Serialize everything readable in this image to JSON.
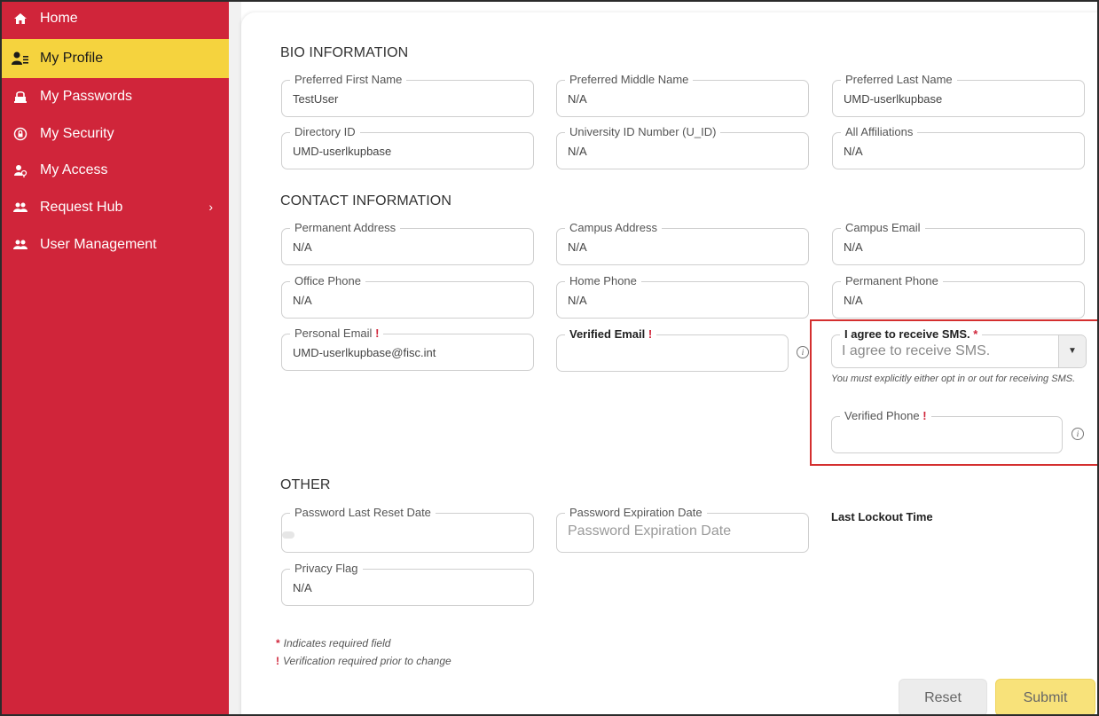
{
  "sidebar": {
    "items": [
      {
        "label": "Home",
        "icon": "home-icon"
      },
      {
        "label": "My Profile",
        "icon": "profile-icon"
      },
      {
        "label": "My Passwords",
        "icon": "password-icon"
      },
      {
        "label": "My Security",
        "icon": "security-icon"
      },
      {
        "label": "My Access",
        "icon": "access-icon"
      },
      {
        "label": "Request Hub",
        "icon": "users-icon"
      },
      {
        "label": "User Management",
        "icon": "users-icon"
      }
    ],
    "active_index": 1,
    "colors": {
      "background": "#d0253a",
      "active": "#f5d33e"
    }
  },
  "sections": {
    "bio": "BIO INFORMATION",
    "contact": "CONTACT INFORMATION",
    "other": "OTHER"
  },
  "bio": {
    "first_name": {
      "label": "Preferred First Name",
      "value": "TestUser"
    },
    "middle_name": {
      "label": "Preferred Middle Name",
      "value": "N/A"
    },
    "last_name": {
      "label": "Preferred Last Name",
      "value": "UMD-userlkupbase"
    },
    "directory_id": {
      "label": "Directory ID",
      "value": "UMD-userlkupbase"
    },
    "uid": {
      "label": "University ID Number (U_ID)",
      "value": "N/A"
    },
    "affiliations": {
      "label": "All Affiliations",
      "value": "N/A"
    }
  },
  "contact": {
    "permanent_address": {
      "label": "Permanent Address",
      "value": "N/A"
    },
    "campus_address": {
      "label": "Campus Address",
      "value": "N/A"
    },
    "campus_email": {
      "label": "Campus Email",
      "value": "N/A"
    },
    "office_phone": {
      "label": "Office Phone",
      "value": "N/A"
    },
    "home_phone": {
      "label": "Home Phone",
      "value": "N/A"
    },
    "permanent_phone": {
      "label": "Permanent Phone",
      "value": "N/A"
    },
    "personal_email": {
      "label": "Personal Email",
      "mark": "!",
      "value": "UMD-userlkupbase@fisc.int"
    },
    "verified_email": {
      "label": "Verified Email",
      "mark": "!",
      "value": ""
    },
    "sms": {
      "label": "I agree to receive SMS.",
      "mark": "*",
      "placeholder": "I agree to receive SMS.",
      "hint": "You must explicitly either opt in or out for receiving SMS."
    },
    "verified_phone": {
      "label": "Verified Phone",
      "mark": "!",
      "value": ""
    }
  },
  "other": {
    "password_last_reset": {
      "label": "Password Last Reset Date"
    },
    "password_expiration": {
      "label": "Password Expiration Date",
      "placeholder": "Password Expiration Date"
    },
    "last_lockout": {
      "label": "Last Lockout Time"
    },
    "privacy_flag": {
      "label": "Privacy Flag",
      "value": "N/A"
    }
  },
  "legend": {
    "required_mark": "*",
    "required_text": "Indicates required field",
    "verify_mark": "!",
    "verify_text": "Verification required prior to change"
  },
  "buttons": {
    "reset": "Reset",
    "submit": "Submit"
  }
}
